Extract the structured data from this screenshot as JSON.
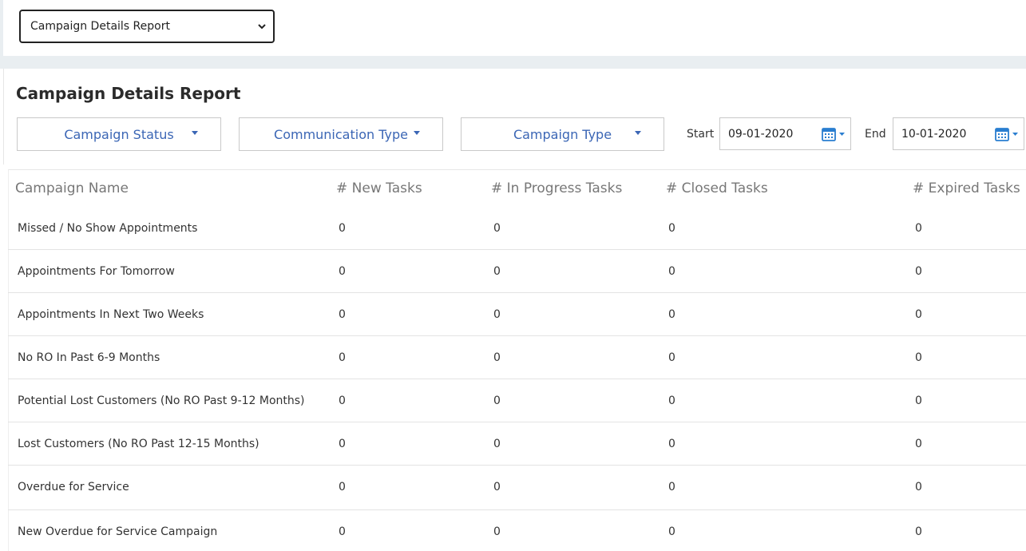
{
  "report_selector": {
    "value": "Campaign Details Report"
  },
  "page": {
    "title": "Campaign Details Report"
  },
  "filters": {
    "campaign_status": "Campaign Status",
    "communication_type": "Communication Type",
    "campaign_type": "Campaign Type"
  },
  "dates": {
    "start_label": "Start",
    "start_value": "09-01-2020",
    "end_label": "End",
    "end_value": "10-01-2020"
  },
  "table": {
    "headers": [
      "Campaign Name",
      "# New Tasks",
      "# In Progress Tasks",
      "# Closed Tasks",
      "# Expired Tasks"
    ],
    "rows": [
      {
        "name": "Missed / No Show Appointments",
        "new": "0",
        "in_progress": "0",
        "closed": "0",
        "expired": "0"
      },
      {
        "name": "Appointments For Tomorrow",
        "new": "0",
        "in_progress": "0",
        "closed": "0",
        "expired": "0"
      },
      {
        "name": "Appointments In Next Two Weeks",
        "new": "0",
        "in_progress": "0",
        "closed": "0",
        "expired": "0"
      },
      {
        "name": "No RO In Past 6-9 Months",
        "new": "0",
        "in_progress": "0",
        "closed": "0",
        "expired": "0"
      },
      {
        "name": "Potential Lost Customers (No RO Past 9-12 Months)",
        "new": "0",
        "in_progress": "0",
        "closed": "0",
        "expired": "0"
      },
      {
        "name": "Lost Customers (No RO Past 12-15 Months)",
        "new": "0",
        "in_progress": "0",
        "closed": "0",
        "expired": "0"
      },
      {
        "name": "Overdue for Service",
        "new": "0",
        "in_progress": "0",
        "closed": "0",
        "expired": "0"
      },
      {
        "name": "New Overdue for Service Campaign",
        "new": "0",
        "in_progress": "0",
        "closed": "0",
        "expired": "0"
      }
    ]
  },
  "colors": {
    "accent": "#3b66b5",
    "calendar_icon": "#2a7ed0",
    "strip": "#e9eef1"
  },
  "icons": {
    "select_chevron": "chevron-down-icon",
    "filter_caret": "caret-down-icon",
    "calendar": "calendar-icon"
  }
}
